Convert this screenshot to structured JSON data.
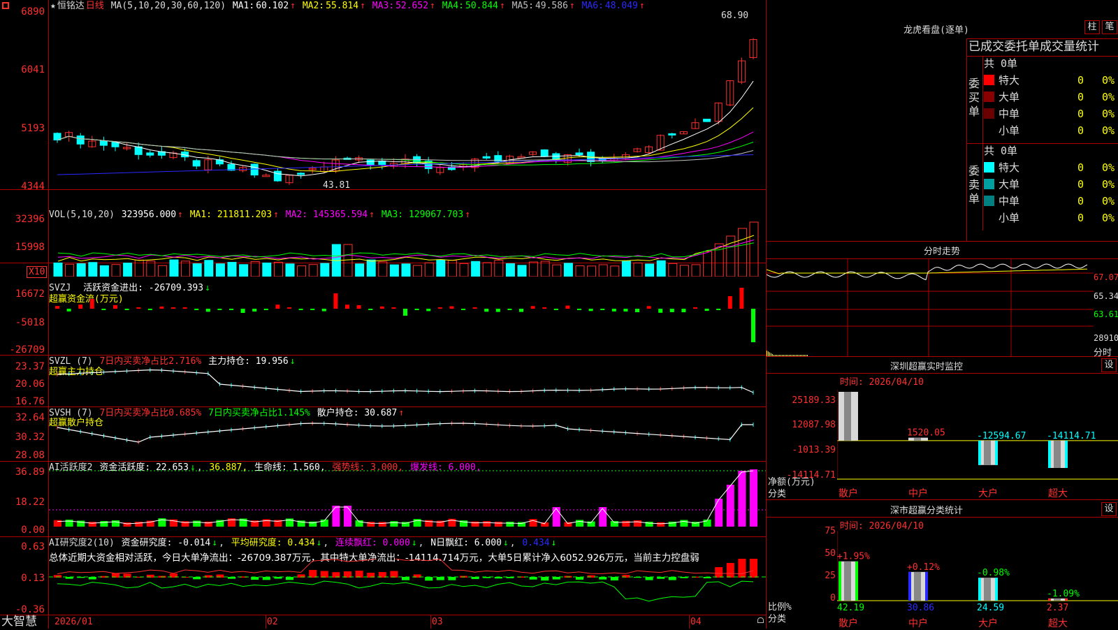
{
  "app": {
    "brand": "大智慧",
    "menu_icon": "square-icon"
  },
  "main": {
    "header": {
      "star": "★",
      "stock_name": "恒铭达",
      "period": "日线",
      "ma_params": "MA(5,10,20,30,60,120)",
      "ma": [
        {
          "label": "MA1:",
          "value": "60.102",
          "color": "#ffffff"
        },
        {
          "label": "MA2:",
          "value": "55.814",
          "color": "#ffff00"
        },
        {
          "label": "MA3:",
          "value": "52.652",
          "color": "#ff00ff"
        },
        {
          "label": "MA4:",
          "value": "50.844",
          "color": "#00ff00"
        },
        {
          "label": "MA5:",
          "value": "49.586",
          "color": "#c0c0c0"
        },
        {
          "label": "MA6:",
          "value": "48.049",
          "color": "#2020ff"
        }
      ],
      "arrow_up": "↑",
      "arrow_down": "↓"
    },
    "price_axis": [
      "6890",
      "6041",
      "5193",
      "4344"
    ],
    "price_high_label": "68.90",
    "price_low_label": "43.81",
    "vol": {
      "params": "VOL(5,10,20)",
      "value": "323956.000",
      "ma1": "MA1: 211811.203",
      "ma2": "MA2: 145365.594",
      "ma3": "MA3: 129067.703",
      "axis": [
        "32396",
        "15998"
      ],
      "unit": "X10"
    },
    "svzj": {
      "name": "SVZJ",
      "text": "活跃资金进出: -26709.393",
      "sub": "超赢资金流(万元)",
      "axis": [
        "16672",
        "-5018",
        "-26709"
      ]
    },
    "svzl": {
      "name": "SVZL (7)",
      "red": "7日内买卖净占比2.716%",
      "text": "主力持仓: 19.956",
      "sub": "超赢主力持仓",
      "axis": [
        "23.37",
        "20.06",
        "16.76"
      ]
    },
    "svsh": {
      "name": "SVSH (7)",
      "red": "7日内买卖净占比0.685%",
      "green": "7日内买卖净占比1.145%",
      "text": "散户持仓: 30.687",
      "sub": "超赢散户持仓",
      "axis": [
        "32.64",
        "30.32",
        "28.08"
      ]
    },
    "ai_active": {
      "name": "AI活跃度2",
      "t1": "资金活跃度: 22.653",
      "t2": "36.887,",
      "t3": "生命线: 1.560,",
      "t4": "强势线: 3.000,",
      "t5": "爆发线: 6.000,",
      "axis": [
        "36.89",
        "18.22",
        "0.00"
      ]
    },
    "ai_research": {
      "name": "AI研究度2(10)",
      "t1": "资金研究度: -0.014",
      "t2": "平均研究度: 0.434",
      "t3": "连续飘红: 0.000",
      "t4": "N日飘红: 6.000",
      "t5": "0.434",
      "summary": "总体近期大资金相对活跃，今日大单净流出：-26709.387万元，其中特大单净流出：-14114.714万元，大单5日累计净入6052.926万元，当前主力控盘弱",
      "axis": [
        "0.63",
        "0.13",
        "-0.36"
      ]
    },
    "dates": [
      "2026/01",
      "02",
      "03",
      "04"
    ]
  },
  "right": {
    "lh": {
      "title": "龙虎看盘(逐单)",
      "btn_zhu": "柱",
      "btn_bi": "笔",
      "subtitle": "已成交委托单成交量统计",
      "buy_group": "委买单",
      "sell_group": "委卖单",
      "buy_count": "共 0单",
      "sell_count": "共 0单",
      "buy_rows": [
        {
          "label": "特大",
          "num": "0",
          "pct": "0%",
          "color": "#ff0000"
        },
        {
          "label": "大单",
          "num": "0",
          "pct": "0%",
          "color": "#a00000"
        },
        {
          "label": "中单",
          "num": "0",
          "pct": "0%",
          "color": "#700000"
        },
        {
          "label": "小单",
          "num": "0",
          "pct": "0%",
          "color": "#000000"
        }
      ],
      "sell_rows": [
        {
          "label": "特大",
          "num": "0",
          "pct": "0%",
          "color": "#00ffff"
        },
        {
          "label": "大单",
          "num": "0",
          "pct": "0%",
          "color": "#00a0a0"
        },
        {
          "label": "中单",
          "num": "0",
          "pct": "0%",
          "color": "#008080"
        },
        {
          "label": "小单",
          "num": "0",
          "pct": "0%",
          "color": "#000000"
        }
      ]
    },
    "fs": {
      "title": "分时走势",
      "axis": [
        "67.07",
        "65.34",
        "63.61"
      ],
      "vol_label": "28910",
      "fs_label": "分时"
    },
    "sz": {
      "title": "深圳超赢实时监控",
      "set": "设",
      "time": "时间: 2026/04/10",
      "axis": [
        "25189.33",
        "12087.98",
        "-1013.39",
        "-14114.71"
      ],
      "unit_label": "净额(万元)",
      "cat_label": "分类",
      "values": [
        "25189.33",
        "1520.05",
        "-12594.67",
        "-14114.71"
      ],
      "cats": [
        "散户",
        "中户",
        "大户",
        "超大"
      ]
    },
    "ss": {
      "title": "深市超赢分类统计",
      "set": "设",
      "time": "时间: 2026/04/10",
      "axis": [
        "75",
        "50",
        "25",
        "0"
      ],
      "pct_label": "比例%",
      "cat_label": "分类",
      "changes": [
        "+1.95%",
        "+0.12%",
        "-0.98%",
        "-1.09%"
      ],
      "values": [
        "42.19",
        "30.86",
        "24.59",
        "2.37"
      ],
      "cats": [
        "散户",
        "中户",
        "大户",
        "超大"
      ]
    }
  },
  "chart_data": [
    {
      "type": "candlestick",
      "title": "恒铭达 日线",
      "ylim": [
        43.44,
        68.9
      ],
      "x": [
        "2026/01",
        "02",
        "03",
        "04"
      ],
      "series": [
        {
          "name": "MA1",
          "last": 60.102
        },
        {
          "name": "MA2",
          "last": 55.814
        },
        {
          "name": "MA3",
          "last": 52.652
        },
        {
          "name": "MA4",
          "last": 50.844
        },
        {
          "name": "MA5",
          "last": 49.586
        },
        {
          "name": "MA6",
          "last": 48.049
        }
      ],
      "annotations": [
        {
          "label": "68.90"
        },
        {
          "label": "43.81"
        }
      ]
    },
    {
      "type": "bar",
      "title": "深圳超赢实时监控",
      "categories": [
        "散户",
        "中户",
        "大户",
        "超大"
      ],
      "values": [
        25189.33,
        1520.05,
        -12594.67,
        -14114.71
      ],
      "ylabel": "净额(万元)"
    },
    {
      "type": "bar",
      "title": "深市超赢分类统计",
      "categories": [
        "散户",
        "中户",
        "大户",
        "超大"
      ],
      "values": [
        42.19,
        30.86,
        24.59,
        2.37
      ],
      "ylim": [
        0,
        75
      ],
      "ylabel": "比例%"
    }
  ]
}
